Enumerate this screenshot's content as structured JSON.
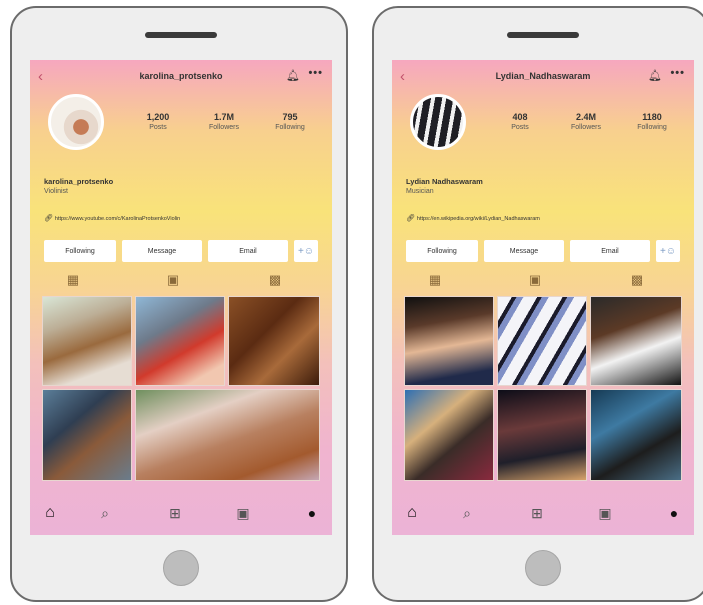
{
  "profiles": [
    {
      "username": "karolina_protsenko",
      "stats": [
        {
          "value": "1,200",
          "label": "Posts"
        },
        {
          "value": "1.7M",
          "label": "Followers"
        },
        {
          "value": "795",
          "label": "Following"
        }
      ],
      "name": "karolina_protsenko",
      "bio": "Violinist",
      "link": "https://www.youtube.com/c/KarolinaProtsenkoViolin",
      "buttons": {
        "following": "Following",
        "message": "Message",
        "email": "Email"
      }
    },
    {
      "username": "Lydian_Nadhaswaram",
      "stats": [
        {
          "value": "408",
          "label": "Posts"
        },
        {
          "value": "2.4M",
          "label": "Followers"
        },
        {
          "value": "1180",
          "label": "Following"
        }
      ],
      "name": "Lydian Nadhaswaram",
      "bio": "Musician",
      "link": "https://en.wikipedia.org/wiki/Lydian_Nadhaswaram",
      "buttons": {
        "following": "Following",
        "message": "Message",
        "email": "Email"
      }
    }
  ],
  "icons": {
    "back": "chevron-left-icon",
    "bell": "bell-icon",
    "more": "more-icon",
    "link": "link-icon",
    "add_user": "add-user-icon",
    "tabs": [
      "grid-icon",
      "reels-icon",
      "tagged-icon"
    ],
    "nav": [
      "home-icon",
      "search-icon",
      "add-post-icon",
      "shop-icon",
      "profile-icon"
    ]
  },
  "colors": {
    "gradient_top": "#f6a7bf",
    "gradient_mid": "#f9e37a",
    "gradient_bottom": "#ecb3d6",
    "phone_body": "#eeeeee"
  }
}
